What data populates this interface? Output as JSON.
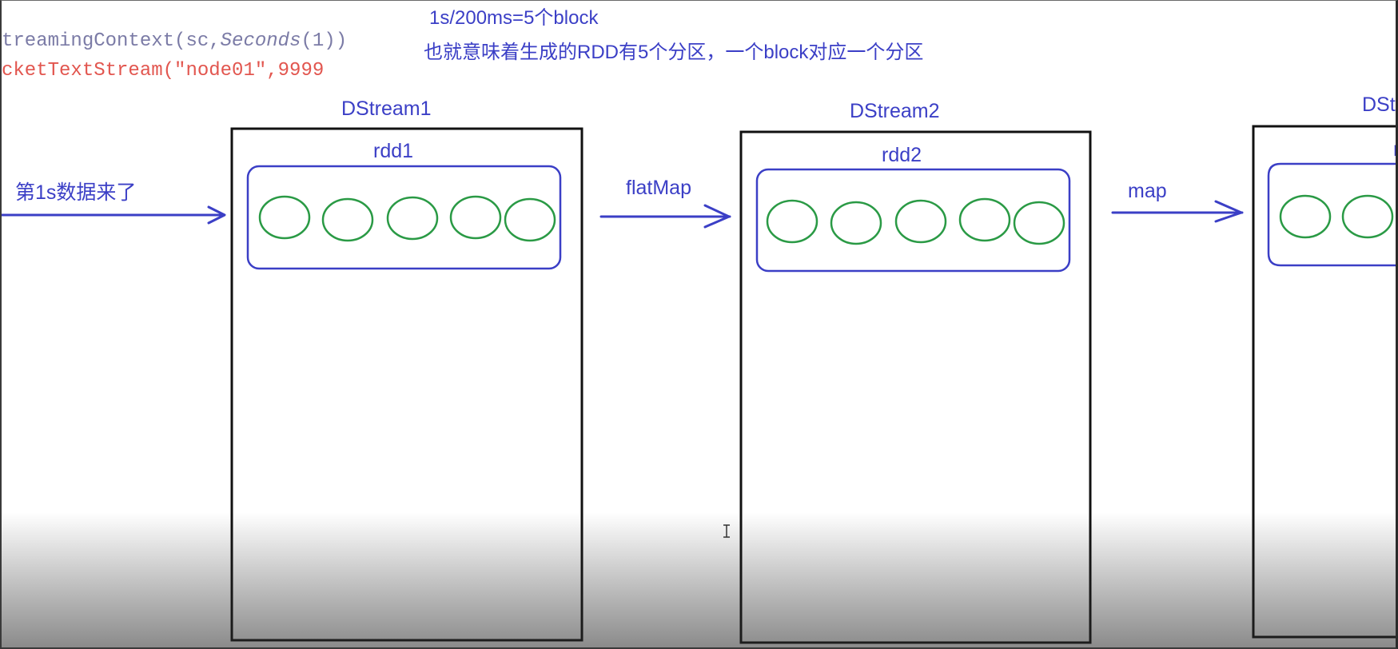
{
  "code": {
    "line1_a": "treamingContext(sc,",
    "line1_b": "Seconds",
    "line1_c": "(1))",
    "line2": "cketTextStream(\"node01\",9999"
  },
  "notes": {
    "batch": "1s/200ms=5个block",
    "explanation": "也就意味着生成的RDD有5个分区，一个block对应一个分区"
  },
  "input_label": "第1s数据来了",
  "dstreams": [
    {
      "label": "DStream1",
      "rdd": "rdd1"
    },
    {
      "label": "DStream2",
      "rdd": "rdd2"
    },
    {
      "label": "DSt",
      "rdd": "r"
    }
  ],
  "operations": [
    "flatMap",
    "map"
  ],
  "colors": {
    "annotation_blue": "#3b3fc6",
    "partition_green": "#2a9a45",
    "code_gray": "#7b7ba6",
    "code_red": "#e2564f",
    "box_black": "#111111"
  }
}
